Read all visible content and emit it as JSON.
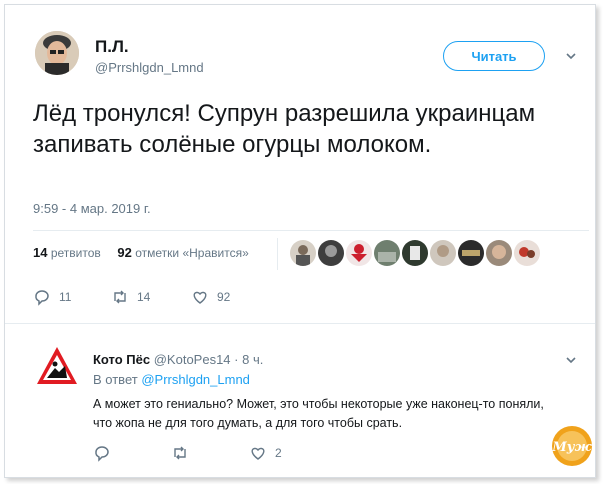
{
  "tweet": {
    "author_name": "П.Л.",
    "author_handle": "@Prrshlgdn_Lmnd",
    "follow_label": "Читать",
    "text": "Лёд тронулся! Супрун разрешила украинцам запивать солёные огурцы молоком.",
    "timestamp": "9:59 - 4 мар. 2019 г.",
    "retweets_count": "14",
    "retweets_label": "ретвитов",
    "likes_count": "92",
    "likes_label": "отметки «Нравится»",
    "actions": {
      "replies": "11",
      "retweets": "14",
      "likes": "92"
    }
  },
  "reply": {
    "author_name": "Кото Пёс",
    "author_handle": "@KotoPes14",
    "time": "· 8 ч.",
    "in_reply_prefix": "В ответ",
    "in_reply_handle": "@Prrshlgdn_Lmnd",
    "text": "А может это гениально? Может, это чтобы некоторые уже наконец-то поняли, что жопа не для того думать, а для того чтобы срать.",
    "actions": {
      "likes": "2"
    }
  },
  "colors": {
    "accent": "#1da1f2",
    "muted": "#657786",
    "text": "#14171a"
  },
  "icons": [
    "chevron-down-icon",
    "reply-icon",
    "retweet-icon",
    "heart-icon",
    "warning-sign-icon",
    "watermark-logo"
  ],
  "watermark_text": "Муж"
}
